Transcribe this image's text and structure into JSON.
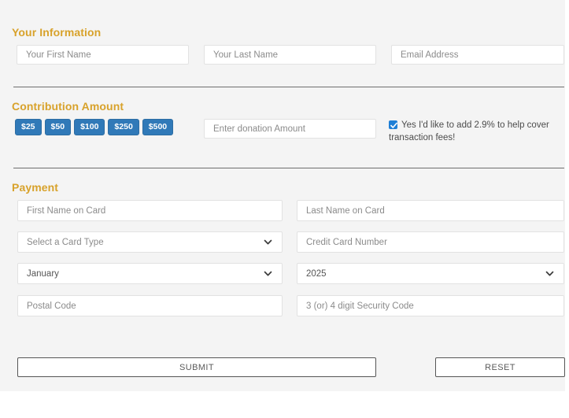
{
  "sections": {
    "your_information": {
      "title": "Your Information",
      "fields": [
        {
          "name": "first-name",
          "placeholder": "Your First Name"
        },
        {
          "name": "last-name",
          "placeholder": "Your Last Name"
        },
        {
          "name": "email",
          "placeholder": "Email Address"
        }
      ]
    },
    "contribution_amount": {
      "title": "Contribution Amount",
      "amount_buttons": [
        "$25",
        "$50",
        "$100",
        "$250",
        "$500"
      ],
      "custom_amount_placeholder": "Enter donation Amount",
      "fee_checkbox": {
        "checked": true,
        "label": "Yes I'd like to add 2.9% to help cover transaction fees!"
      }
    },
    "payment": {
      "title": "Payment",
      "first_name_on_card_placeholder": "First Name on Card",
      "last_name_on_card_placeholder": "Last Name on Card",
      "card_type_value": "Select a Card Type",
      "card_number_placeholder": "Credit Card Number",
      "expiry_month_value": "January",
      "expiry_year_value": "2025",
      "postal_code_placeholder": "Postal Code",
      "security_code_placeholder": "3 (or) 4 digit Security Code"
    }
  },
  "actions": {
    "submit_label": "SUBMIT",
    "reset_label": "RESET"
  },
  "colors": {
    "heading": "#d8a22b",
    "amount_button": "#3079b8",
    "checkbox": "#1f7fd6",
    "panel_bg": "#f4f4f4"
  }
}
